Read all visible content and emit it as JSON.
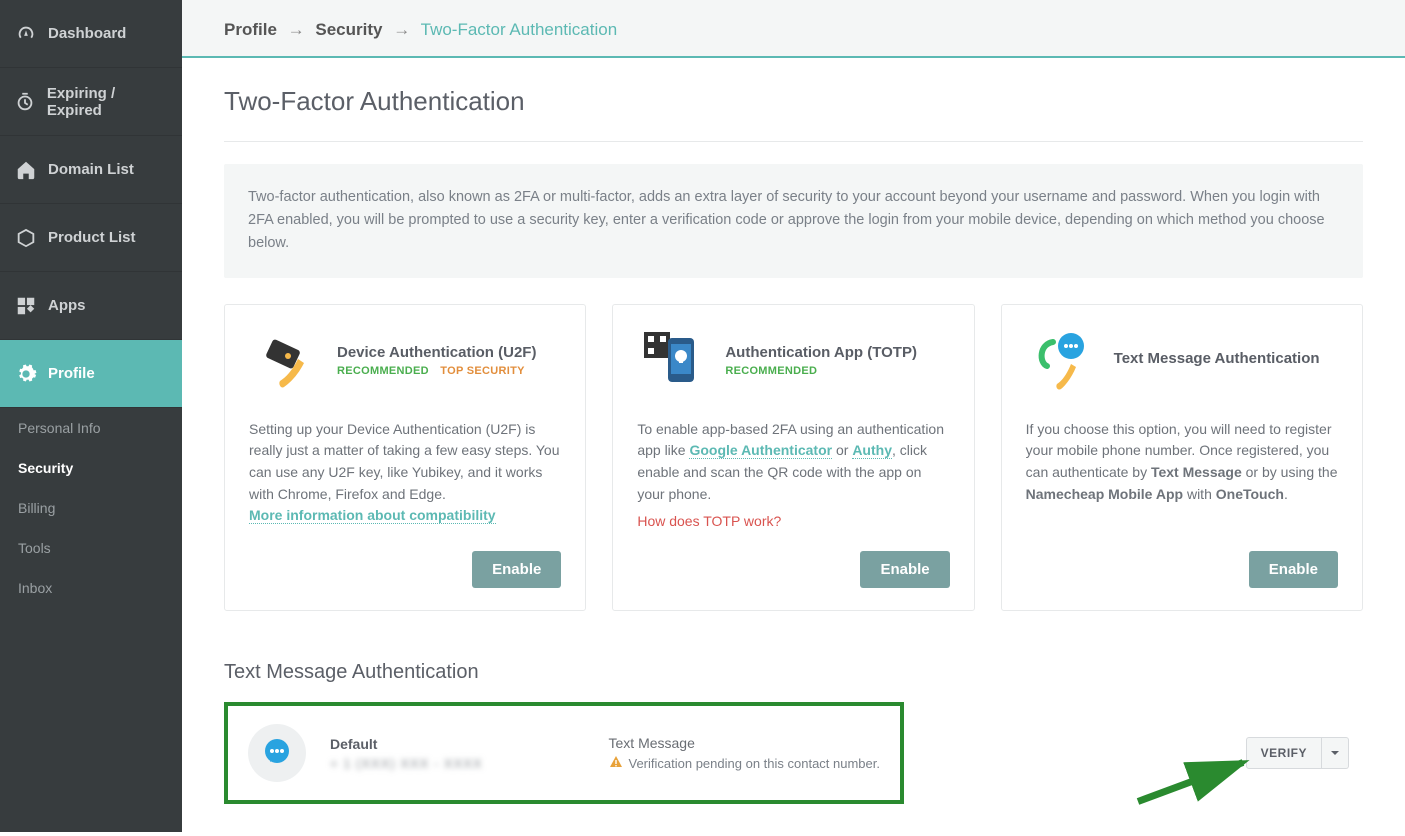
{
  "sidebar": {
    "items": [
      {
        "label": "Dashboard"
      },
      {
        "label": "Expiring / Expired"
      },
      {
        "label": "Domain List"
      },
      {
        "label": "Product List"
      },
      {
        "label": "Apps"
      },
      {
        "label": "Profile"
      }
    ],
    "sub": [
      {
        "label": "Personal Info"
      },
      {
        "label": "Security"
      },
      {
        "label": "Billing"
      },
      {
        "label": "Tools"
      },
      {
        "label": "Inbox"
      }
    ]
  },
  "breadcrumb": {
    "a": "Profile",
    "b": "Security",
    "c": "Two-Factor Authentication",
    "sep": "→"
  },
  "page": {
    "title": "Two-Factor Authentication",
    "explain": "Two-factor authentication, also known as 2FA or multi-factor, adds an extra layer of security to your account beyond your username and password. When you login with 2FA enabled, you will be prompted to use a security key, enter a verification code or approve the login from your mobile device, depending on which method you choose below."
  },
  "cards": {
    "u2f": {
      "title": "Device Authentication (U2F)",
      "recommended": "RECOMMENDED",
      "top": "TOP SECURITY",
      "body": "Setting up your Device Authentication (U2F) is really just a matter of taking a few easy steps. You can use any U2F key, like Yubikey, and it works with Chrome, Firefox and Edge.",
      "link": "More information about compatibility",
      "enable": "Enable"
    },
    "totp": {
      "title": "Authentication App (TOTP)",
      "recommended": "RECOMMENDED",
      "body_pre": "To enable app-based 2FA using an authentication app like ",
      "link1": "Google Authenticator",
      "body_mid": " or ",
      "link2": "Authy",
      "body_post": ", click enable and scan the QR code with the app on your phone.",
      "red": "How does TOTP work?",
      "enable": "Enable"
    },
    "sms": {
      "title": "Text Message Authentication",
      "body_pre": "If you choose this option, you will need to register your mobile phone number. Once registered, you can authenticate by ",
      "b1": "Text Message",
      "body_mid": " or by using the ",
      "b2": "Namecheap Mobile App",
      "body_post": " with ",
      "b3": "OneTouch",
      "body_end": ".",
      "enable": "Enable"
    }
  },
  "sms_section": {
    "title": "Text Message Authentication",
    "default_label": "Default",
    "phone": "+ 1 (XXX) XXX - XXXX",
    "method": "Text Message",
    "pending": "Verification pending on this contact number.",
    "verify": "VERIFY"
  }
}
